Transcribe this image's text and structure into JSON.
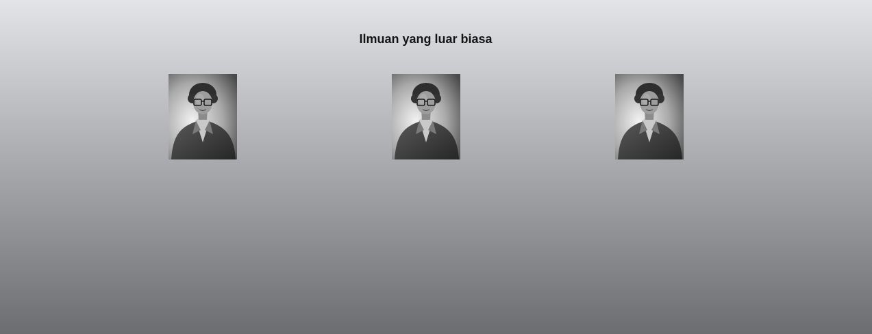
{
  "page": {
    "heading": "Ilmuan yang luar biasa"
  },
  "gallery": {
    "images": [
      {
        "icon": "portrait-photo",
        "style": "black-and-white"
      },
      {
        "icon": "portrait-photo",
        "style": "black-and-white"
      },
      {
        "icon": "portrait-photo",
        "style": "black-and-white"
      }
    ]
  },
  "colors": {
    "background_top": "#e3e4e7",
    "background_bottom": "#6c6d70",
    "heading_text": "#141414"
  }
}
